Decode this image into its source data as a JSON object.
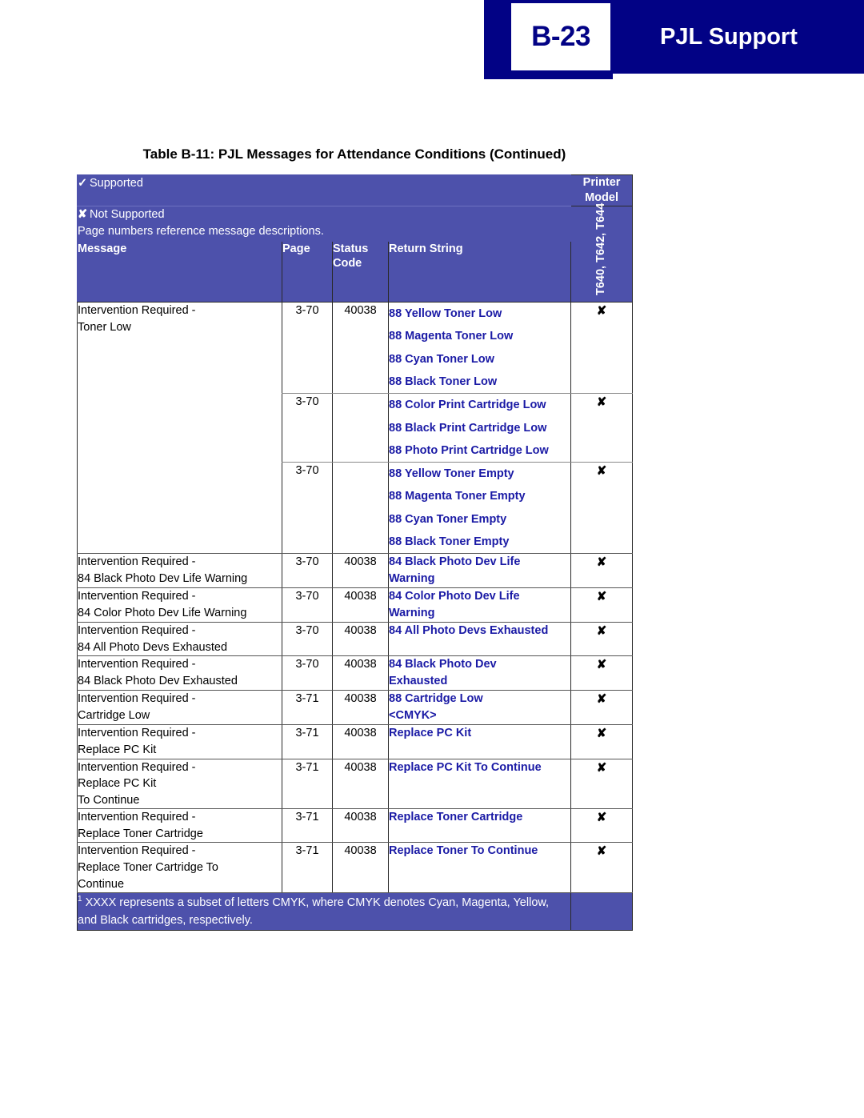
{
  "header": {
    "page_number": "B-23",
    "title": "PJL Support",
    "banner_color": "#020285",
    "page_number_color": "#020285"
  },
  "table": {
    "title": "Table B-11:  PJL Messages for Attendance Conditions (Continued)",
    "header_bg_color": "#4d51ab",
    "return_string_color": "#1a1aa5",
    "legend": {
      "supported_glyph": "✓",
      "supported_label": "Supported",
      "not_supported_glyph": "✘",
      "not_supported_label": "Not Supported",
      "note": "Page numbers reference message descriptions."
    },
    "printer_model_header": {
      "line1": "Printer",
      "line2": "Model",
      "models": "T640, T642, T644"
    },
    "columns": {
      "message": "Message",
      "page": "Page",
      "status_code_line1": "Status",
      "status_code_line2": "Code",
      "return_string": "Return String"
    },
    "rows": [
      {
        "message": "Intervention Required -\nToner Low",
        "groups": [
          {
            "page": "3-70",
            "status_code": "40038",
            "return_strings": [
              "88 Yellow Toner Low",
              "88 Magenta Toner Low",
              "88 Cyan Toner Low",
              "88 Black Toner Low"
            ],
            "supported": "✘"
          },
          {
            "page": "3-70",
            "status_code": "",
            "return_strings": [
              "88 Color Print Cartridge Low",
              "88 Black Print Cartridge Low",
              "88 Photo Print Cartridge Low"
            ],
            "supported": "✘"
          },
          {
            "page": "3-70",
            "status_code": "",
            "return_strings": [
              "88 Yellow Toner Empty",
              "88 Magenta Toner Empty",
              "88 Cyan Toner Empty",
              "88 Black Toner Empty"
            ],
            "supported": "✘"
          }
        ]
      },
      {
        "message": "Intervention Required -\n84 Black Photo Dev Life Warning",
        "groups": [
          {
            "page": "3-70",
            "status_code": "40038",
            "return_strings": [
              "84 Black Photo Dev Life",
              "Warning"
            ],
            "supported": "✘"
          }
        ]
      },
      {
        "message": "Intervention Required -\n84 Color Photo Dev Life Warning",
        "groups": [
          {
            "page": "3-70",
            "status_code": "40038",
            "return_strings": [
              "84 Color Photo Dev Life",
              "Warning"
            ],
            "supported": "✘"
          }
        ]
      },
      {
        "message": "Intervention Required -\n84 All Photo Devs Exhausted",
        "groups": [
          {
            "page": "3-70",
            "status_code": "40038",
            "return_strings": [
              "84 All Photo Devs Exhausted"
            ],
            "supported": "✘"
          }
        ]
      },
      {
        "message": "Intervention Required -\n84 Black Photo Dev Exhausted",
        "groups": [
          {
            "page": "3-70",
            "status_code": "40038",
            "return_strings": [
              "84 Black Photo Dev",
              "Exhausted"
            ],
            "supported": "✘"
          }
        ]
      },
      {
        "message": "Intervention Required -\nCartridge Low",
        "groups": [
          {
            "page": "3-71",
            "status_code": "40038",
            "return_strings": [
              "88 Cartridge Low",
              "<CMYK>"
            ],
            "supported": "✘"
          }
        ]
      },
      {
        "message": "Intervention Required -\nReplace PC Kit",
        "groups": [
          {
            "page": "3-71",
            "status_code": "40038",
            "return_strings": [
              "Replace PC Kit"
            ],
            "supported": "✘"
          }
        ]
      },
      {
        "message": "Intervention Required -\nReplace PC Kit\nTo Continue",
        "groups": [
          {
            "page": "3-71",
            "status_code": "40038",
            "return_strings": [
              "Replace PC Kit To Continue"
            ],
            "supported": "✘"
          }
        ]
      },
      {
        "message": "Intervention Required -\nReplace Toner Cartridge",
        "groups": [
          {
            "page": "3-71",
            "status_code": "40038",
            "return_strings": [
              "Replace Toner Cartridge"
            ],
            "supported": "✘"
          }
        ]
      },
      {
        "message": "Intervention Required -\nReplace Toner Cartridge To\nContinue",
        "groups": [
          {
            "page": "3-71",
            "status_code": "40038",
            "return_strings": [
              "Replace Toner To Continue"
            ],
            "supported": "✘"
          }
        ]
      }
    ],
    "footnote": {
      "marker": "1",
      "text": " XXXX represents a subset of letters CMYK, where CMYK denotes Cyan, Magenta, Yellow, and Black cartridges, respectively."
    }
  }
}
